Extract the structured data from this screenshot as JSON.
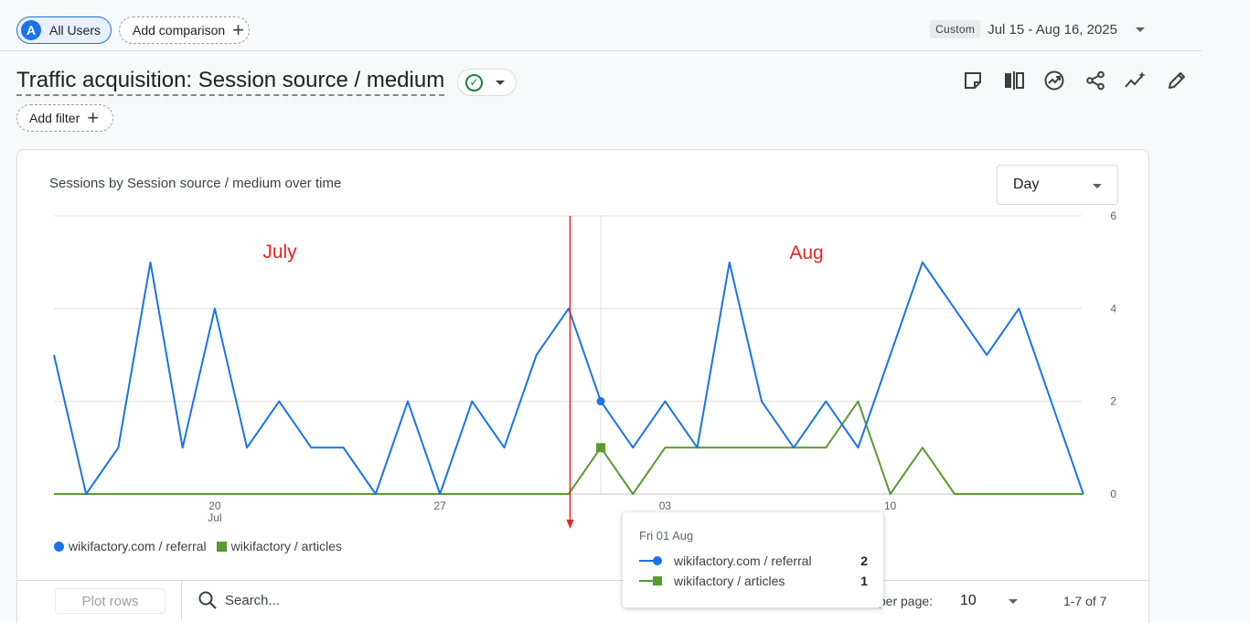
{
  "comparison": {
    "segment_avatar": "A",
    "segment_label": "All Users",
    "add_comparison_label": "Add comparison"
  },
  "date": {
    "custom_label": "Custom",
    "range": "Jul 15 - Aug 16, 2025"
  },
  "report": {
    "title": "Traffic acquisition: Session source / medium",
    "add_filter_label": "Add filter"
  },
  "card": {
    "title": "Sessions by Session source / medium over time",
    "granularity": "Day"
  },
  "legend": [
    {
      "label": "wikifactory.com / referral",
      "color": "#1a73e8",
      "symbol": "circle"
    },
    {
      "label": "wikifactory / articles",
      "color": "#5b9a2f",
      "symbol": "square"
    }
  ],
  "table_controls": {
    "plot_rows_label": "Plot rows",
    "search_placeholder": "Search...",
    "rows_per_page_label": "Rows per page:",
    "rows_per_page_value": "10",
    "pager": "1-7 of 7"
  },
  "tooltip": {
    "date": "Fri 01 Aug",
    "rows": [
      {
        "label": "wikifactory.com / referral",
        "value": "2"
      },
      {
        "label": "wikifactory / articles",
        "value": "1"
      }
    ]
  },
  "chart_data": {
    "type": "line",
    "x": [
      "Jul 15",
      "Jul 16",
      "Jul 17",
      "Jul 18",
      "Jul 19",
      "Jul 20",
      "Jul 21",
      "Jul 22",
      "Jul 23",
      "Jul 24",
      "Jul 25",
      "Jul 26",
      "Jul 27",
      "Jul 28",
      "Jul 29",
      "Jul 30",
      "Jul 31",
      "Aug 1",
      "Aug 2",
      "Aug 3",
      "Aug 4",
      "Aug 5",
      "Aug 6",
      "Aug 7",
      "Aug 8",
      "Aug 9",
      "Aug 10",
      "Aug 11",
      "Aug 12",
      "Aug 13",
      "Aug 14",
      "Aug 15",
      "Aug 16"
    ],
    "x_tick_labels": [
      {
        "label": "20",
        "sub": "Jul",
        "index": 5
      },
      {
        "label": "27",
        "sub": "",
        "index": 12
      },
      {
        "label": "03",
        "sub": "Aug",
        "index": 19
      },
      {
        "label": "10",
        "sub": "",
        "index": 26
      }
    ],
    "series": [
      {
        "name": "wikifactory.com / referral",
        "color": "#1a73e8",
        "values": [
          3,
          0,
          1,
          5,
          1,
          4,
          1,
          2,
          1,
          1,
          0,
          2,
          0,
          2,
          1,
          3,
          4,
          2,
          1,
          2,
          1,
          5,
          2,
          1,
          2,
          1,
          3,
          5,
          4,
          3,
          4,
          2,
          0
        ]
      },
      {
        "name": "wikifactory / articles",
        "color": "#5b9a2f",
        "values": [
          0,
          0,
          0,
          0,
          0,
          0,
          0,
          0,
          0,
          0,
          0,
          0,
          0,
          0,
          0,
          0,
          0,
          1,
          0,
          1,
          1,
          1,
          1,
          1,
          1,
          2,
          0,
          1,
          0,
          0,
          0,
          0,
          0
        ]
      }
    ],
    "ylim": [
      0,
      6
    ],
    "y_ticks": [
      "0",
      "2",
      "4",
      "6"
    ],
    "y_axis_side": "right",
    "grid": true,
    "hover_index": 17,
    "annotations": [
      {
        "text": "July",
        "color": "#e8251f"
      },
      {
        "text": "Aug",
        "color": "#e8251f"
      }
    ],
    "annotation_marker": {
      "between_index": [
        16,
        17
      ],
      "color": "#e8251f"
    }
  }
}
